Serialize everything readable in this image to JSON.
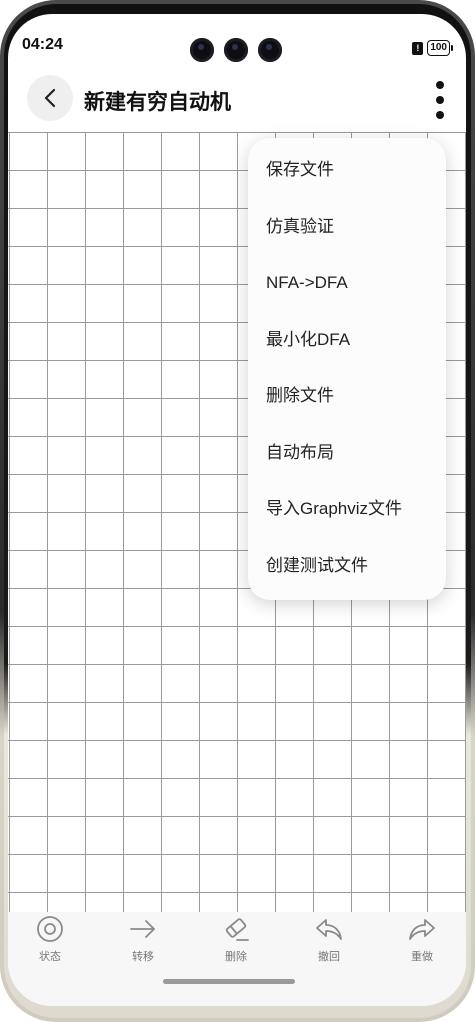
{
  "status": {
    "time": "04:24",
    "sim": "!",
    "battery": "100"
  },
  "header": {
    "title": "新建有穷自动机"
  },
  "menu": {
    "items": [
      {
        "label": "保存文件"
      },
      {
        "label": "仿真验证"
      },
      {
        "label": "NFA->DFA"
      },
      {
        "label": "最小化DFA"
      },
      {
        "label": "删除文件"
      },
      {
        "label": "自动布局"
      },
      {
        "label": "导入Graphviz文件"
      },
      {
        "label": "创建测试文件"
      }
    ]
  },
  "toolbar": {
    "items": [
      {
        "label": "状态",
        "icon": "target-icon"
      },
      {
        "label": "转移",
        "icon": "arrow-right-icon"
      },
      {
        "label": "删除",
        "icon": "eraser-icon"
      },
      {
        "label": "撤回",
        "icon": "undo-icon"
      },
      {
        "label": "重做",
        "icon": "redo-icon"
      }
    ]
  }
}
